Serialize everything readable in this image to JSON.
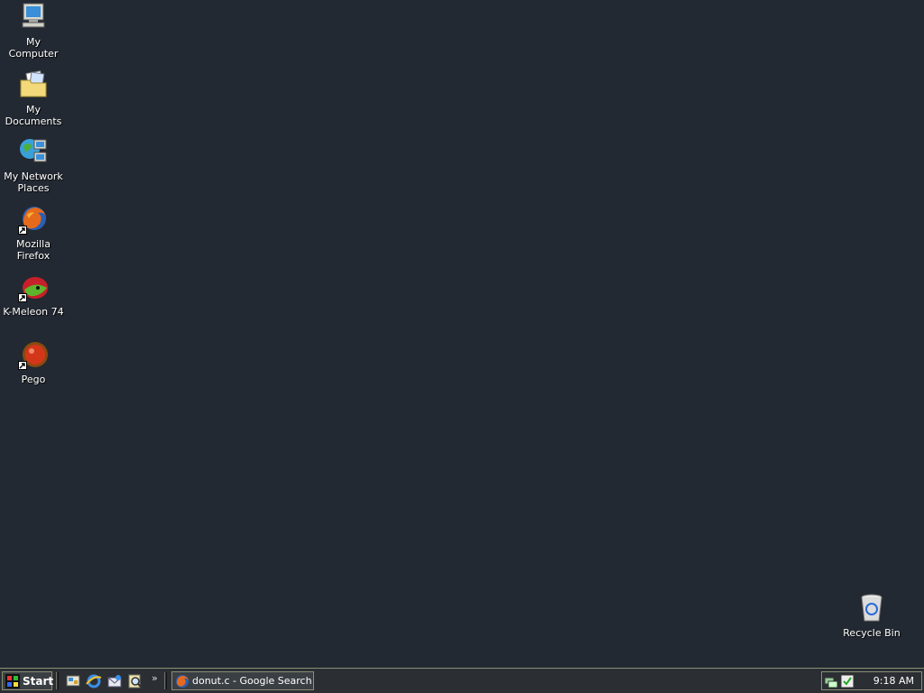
{
  "desktop": {
    "background_color": "#232932",
    "icons": [
      {
        "label": "My Computer",
        "icon": "computer-icon"
      },
      {
        "label": "My Documents",
        "icon": "documents-folder-icon"
      },
      {
        "label": "My Network Places",
        "icon": "network-places-icon"
      },
      {
        "label": "Mozilla Firefox",
        "icon": "firefox-icon",
        "shortcut": true
      },
      {
        "label": "K-Meleon 74",
        "icon": "kmeleon-icon",
        "shortcut": true
      },
      {
        "label": "Pego",
        "icon": "pego-icon",
        "shortcut": true
      },
      {
        "label": "Recycle Bin",
        "icon": "recycle-bin-icon"
      }
    ]
  },
  "taskbar": {
    "start_label": "Start",
    "quick_launch": [
      "show-desktop-icon",
      "internet-explorer-icon",
      "outlook-express-icon",
      "search-icon"
    ],
    "more_label": "»",
    "tasks": [
      {
        "label": "donut.c - Google Search -...",
        "icon": "firefox-icon"
      }
    ],
    "tray_icons": [
      "network-icon",
      "security-icon"
    ],
    "clock": "9:18 AM"
  }
}
